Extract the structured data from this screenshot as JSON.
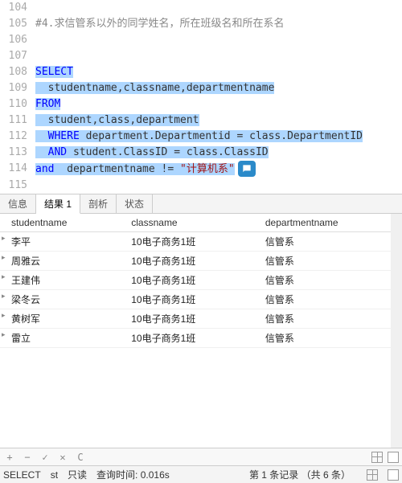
{
  "editor": {
    "lines": [
      {
        "num": "104",
        "plain": ""
      },
      {
        "num": "105",
        "comment": "#4.求信管系以外的同学姓名，所在班级名和所在系名"
      },
      {
        "num": "106",
        "plain": ""
      },
      {
        "num": "107",
        "plain": ""
      },
      {
        "num": "108",
        "sel_kw": "SELECT"
      },
      {
        "num": "109",
        "indent": "  ",
        "sel_plain": "studentname,classname,departmentname"
      },
      {
        "num": "110",
        "sel_kw": "FROM"
      },
      {
        "num": "111",
        "indent": "  ",
        "sel_plain": "student,class,department"
      },
      {
        "num": "112",
        "indent": "  ",
        "sel_kw_head": "WHERE",
        "sel_tail": " department.Departmentid = class.DepartmentID"
      },
      {
        "num": "113",
        "indent": "  ",
        "sel_kw_head": "AND",
        "sel_tail": " student.ClassID = class.ClassID"
      },
      {
        "num": "114",
        "sel_kw_head": "and",
        "sel_mid": "  departmentname != ",
        "sel_str": "\"计算机系\""
      },
      {
        "num": "115",
        "cursor": true
      }
    ]
  },
  "tabs": [
    {
      "label": "信息",
      "active": false
    },
    {
      "label": "结果 1",
      "active": true
    },
    {
      "label": "剖析",
      "active": false
    },
    {
      "label": "状态",
      "active": false
    }
  ],
  "results": {
    "columns": [
      "studentname",
      "classname",
      "departmentname"
    ],
    "rows": [
      [
        "李平",
        "10电子商务1班",
        "信管系"
      ],
      [
        "周雅云",
        "10电子商务1班",
        "信管系"
      ],
      [
        "王建伟",
        "10电子商务1班",
        "信管系"
      ],
      [
        "梁冬云",
        "10电子商务1班",
        "信管系"
      ],
      [
        "黄树军",
        "10电子商务1班",
        "信管系"
      ],
      [
        "雷立",
        "10电子商务1班",
        "信管系"
      ]
    ]
  },
  "toolbar": {
    "add": "+",
    "remove": "−",
    "confirm": "✓",
    "cancel": "✕",
    "refresh": "C"
  },
  "status": {
    "query_type": "SELECT",
    "mode_short": "st",
    "mode": "只读",
    "time_label": "查询时间:",
    "time_value": "0.016s",
    "record_label": "第 1 条记录 （共 6 条）"
  }
}
